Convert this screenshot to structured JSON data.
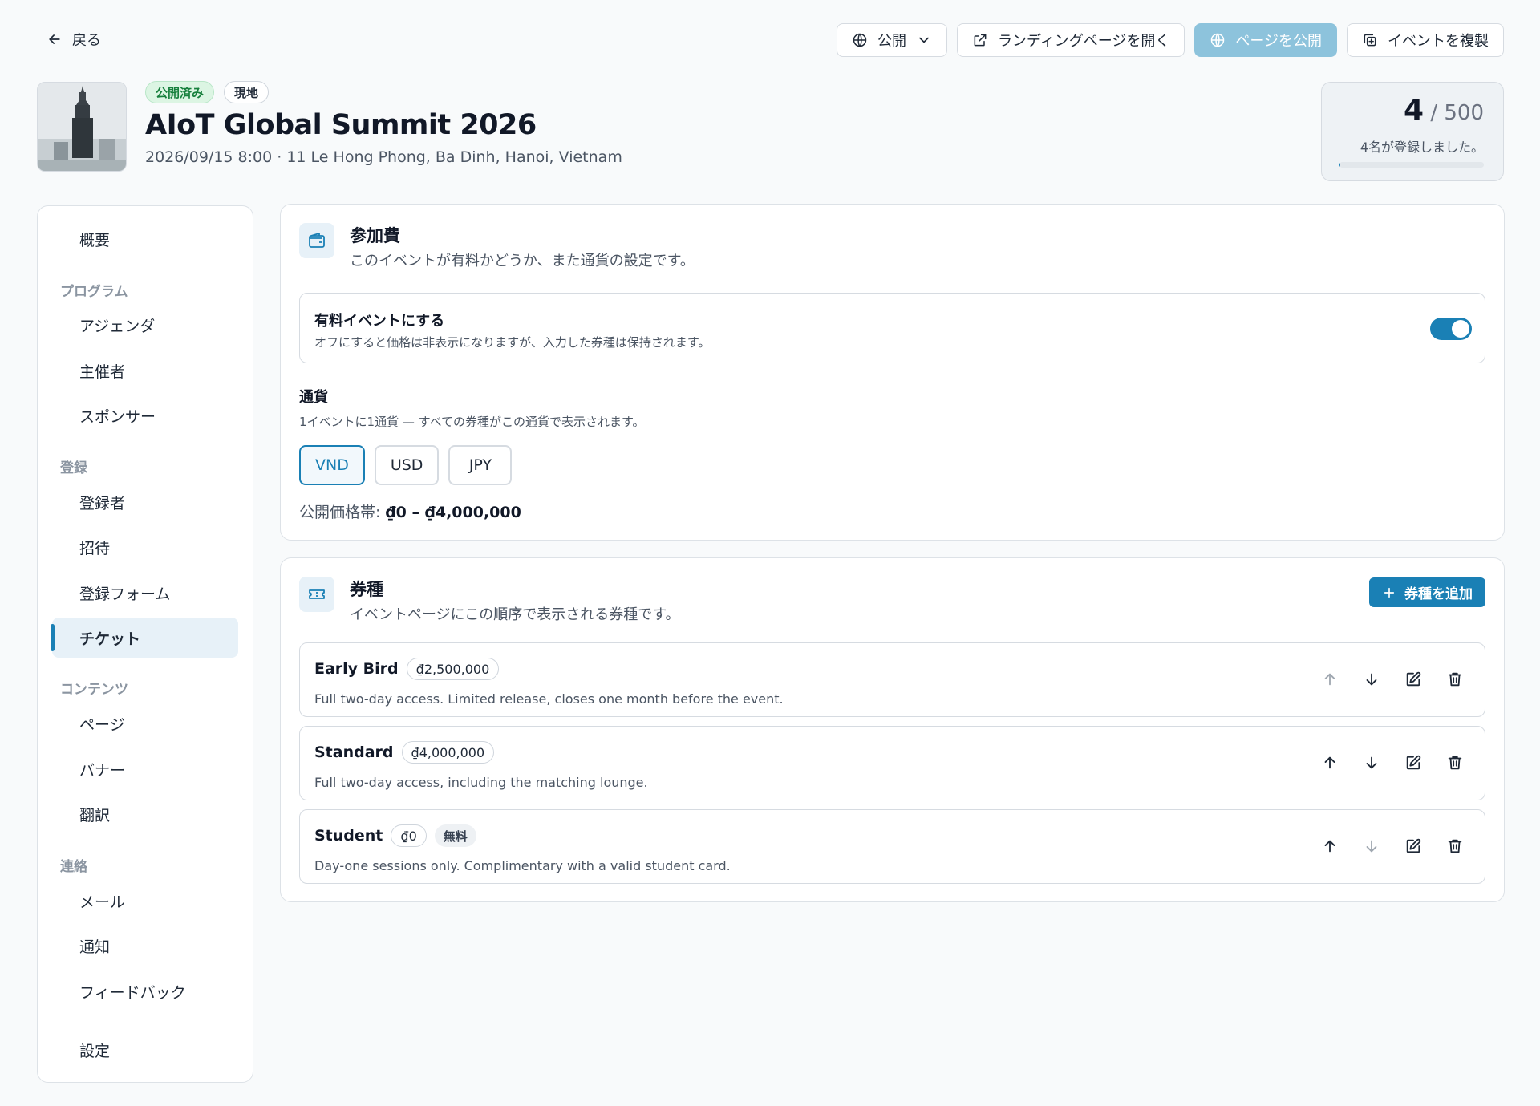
{
  "topbar": {
    "back_label": "戻る",
    "visibility_label": "公開",
    "open_landing_label": "ランディングページを開く",
    "publish_label": "ページを公開",
    "duplicate_label": "イベントを複製"
  },
  "event": {
    "status_badge": "公開済み",
    "format_badge": "現地",
    "title": "AIoT Global Summit 2026",
    "meta": "2026/09/15 8:00 · 11 Le Hong Phong, Ba Dinh, Hanoi, Vietnam"
  },
  "registration": {
    "count": "4",
    "capacity": "/ 500",
    "text": "4名が登録しました。",
    "progress_fraction": 0.008
  },
  "sidebar": {
    "overview": "概要",
    "group_program": "プログラム",
    "agenda": "アジェンダ",
    "organizers": "主催者",
    "sponsors": "スポンサー",
    "group_registration": "登録",
    "registrants": "登録者",
    "invitations": "招待",
    "registration_form": "登録フォーム",
    "tickets": "チケット",
    "group_content": "コンテンツ",
    "pages": "ページ",
    "banners": "バナー",
    "translations": "翻訳",
    "group_contact": "連絡",
    "email": "メール",
    "notifications": "通知",
    "feedback": "フィードバック",
    "settings": "設定"
  },
  "fee": {
    "title": "参加費",
    "subtitle": "このイベントが有料かどうか、また通貨の設定です。",
    "paid_title": "有料イベントにする",
    "paid_subtitle": "オフにすると価格は非表示になりますが、入力した券種は保持されます。",
    "paid_enabled": true,
    "currency_label": "通貨",
    "currency_help": "1イベントに1通貨 — すべての券種がこの通貨で表示されます。",
    "currencies": [
      "VND",
      "USD",
      "JPY"
    ],
    "selected_currency": "VND",
    "price_range_label": "公開価格帯:",
    "price_range_value": "₫0 – ₫4,000,000"
  },
  "tickets": {
    "title": "券種",
    "subtitle": "イベントページにこの順序で表示される券種です。",
    "add_label": "券種を追加",
    "items": [
      {
        "name": "Early Bird",
        "price": "₫2,500,000",
        "free_badge": "",
        "description": "Full two-day access. Limited release, closes one month before the event."
      },
      {
        "name": "Standard",
        "price": "₫4,000,000",
        "free_badge": "",
        "description": "Full two-day access, including the matching lounge."
      },
      {
        "name": "Student",
        "price": "₫0",
        "free_badge": "無料",
        "description": "Day-one sessions only. Complimentary with a valid student card."
      }
    ]
  },
  "colors": {
    "accent": "#1a80b5",
    "published_badge": "#17803d",
    "publish_button": "#8dc3dc"
  }
}
